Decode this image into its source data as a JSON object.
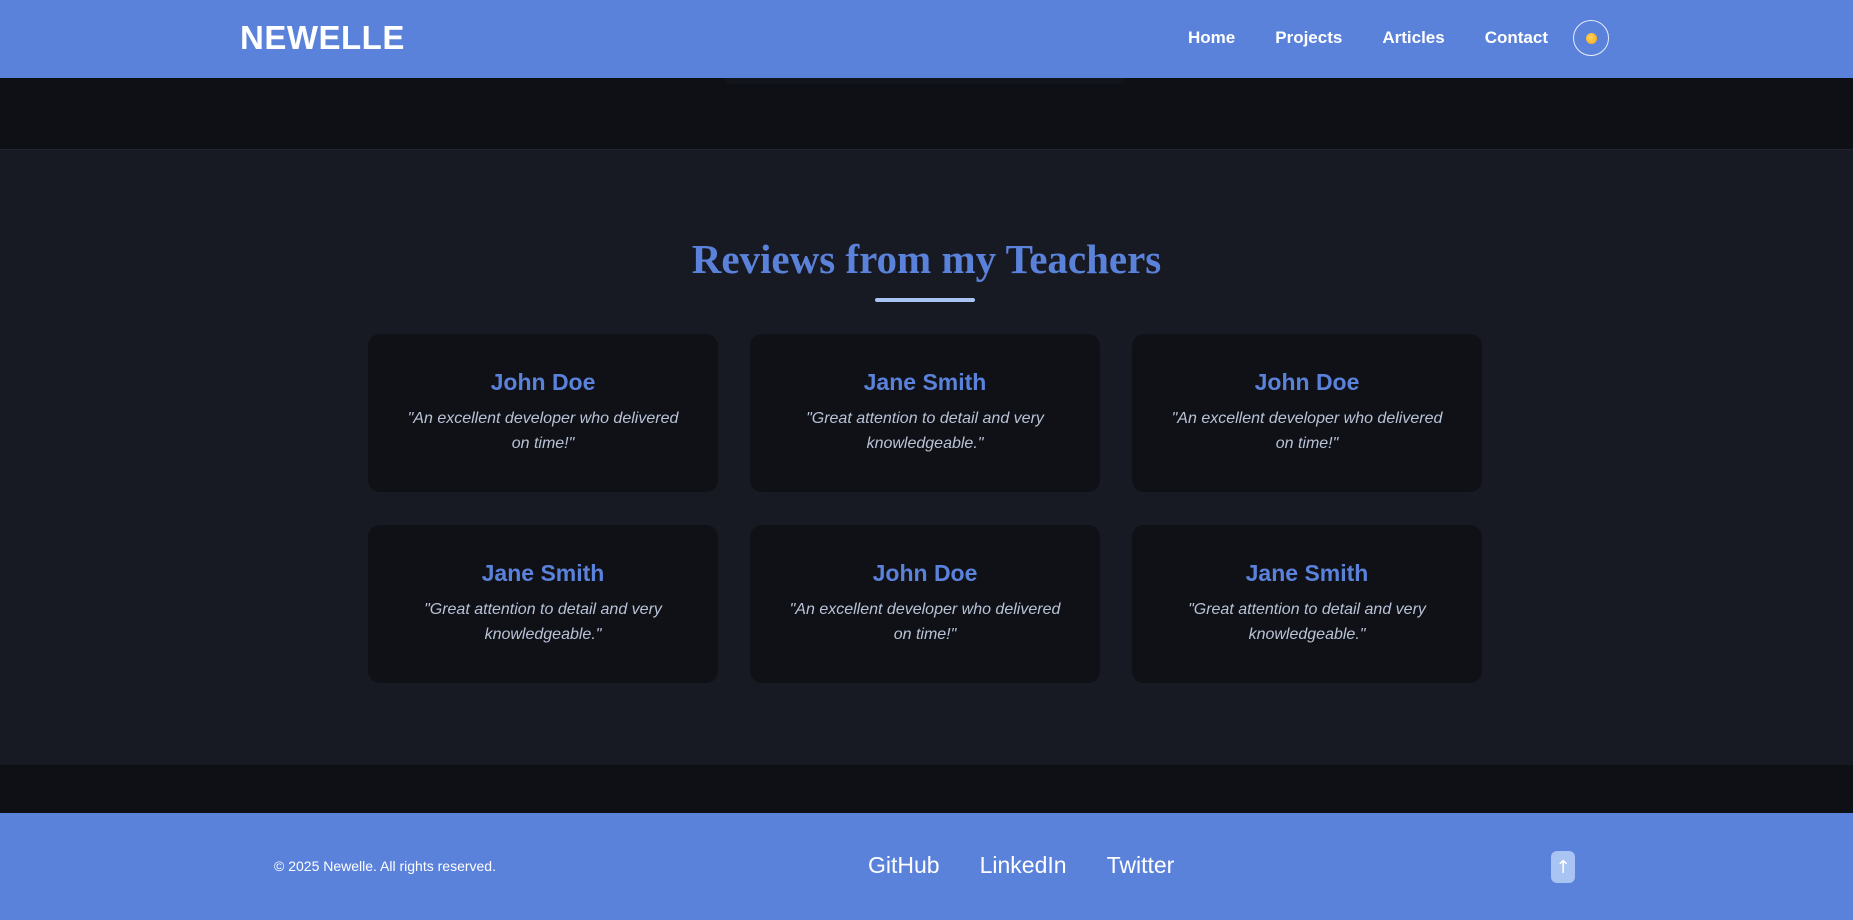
{
  "header": {
    "brand": "NEWELLE",
    "nav": [
      "Home",
      "Projects",
      "Articles",
      "Contact"
    ],
    "theme_toggle_icon": "sun-icon"
  },
  "reviews": {
    "title": "Reviews from my Teachers",
    "items": [
      {
        "name": "John Doe",
        "quote": "\"An excellent developer who delivered on time!\""
      },
      {
        "name": "Jane Smith",
        "quote": "\"Great attention to detail and very knowledgeable.\""
      },
      {
        "name": "John Doe",
        "quote": "\"An excellent developer who delivered on time!\""
      },
      {
        "name": "Jane Smith",
        "quote": "\"Great attention to detail and very knowledgeable.\""
      },
      {
        "name": "John Doe",
        "quote": "\"An excellent developer who delivered on time!\""
      },
      {
        "name": "Jane Smith",
        "quote": "\"Great attention to detail and very knowledgeable.\""
      }
    ]
  },
  "footer": {
    "copyright": "© 2025 Newelle. All rights reserved.",
    "social": [
      "GitHub",
      "LinkedIn",
      "Twitter"
    ],
    "back_to_top": "↑"
  },
  "colors": {
    "accent": "#5b82db",
    "background": "#0e1016",
    "section_background": "#171a23",
    "card_background": "#0f1117",
    "quote_text": "#b9c3d6",
    "underline": "#a9c4f2"
  }
}
